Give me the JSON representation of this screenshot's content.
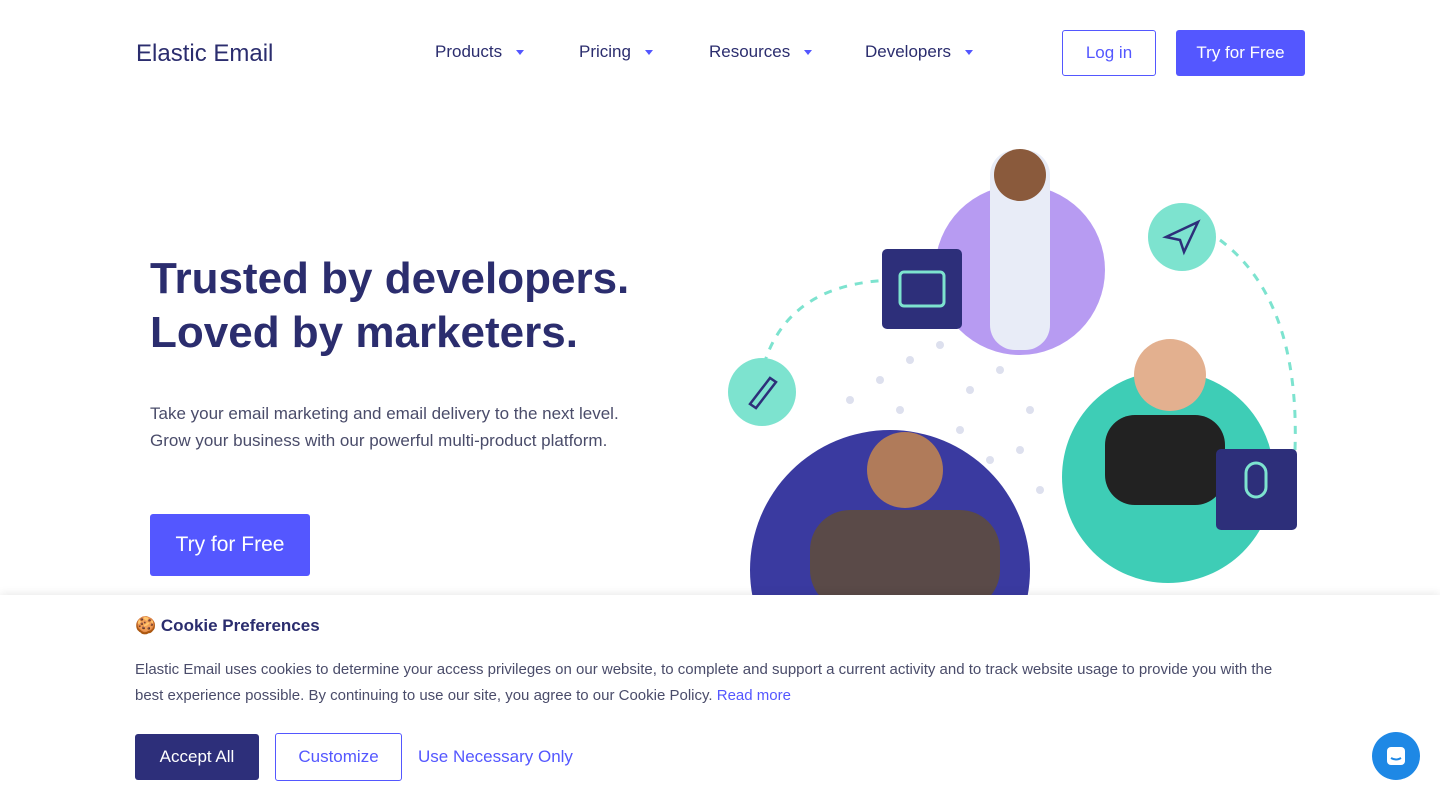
{
  "header": {
    "logo": "Elastic Email",
    "logo_icon": "link-cloud-icon",
    "nav": [
      {
        "label": "Products"
      },
      {
        "label": "Pricing"
      },
      {
        "label": "Resources"
      },
      {
        "label": "Developers"
      }
    ],
    "login": "Log in",
    "try": "Try for Free"
  },
  "hero": {
    "title_line1": "Trusted by developers.",
    "title_line2": "Loved by marketers.",
    "sub_line1": "Take your email marketing and email delivery to the next level.",
    "sub_line2": "Grow your business with our powerful multi-product platform.",
    "cta": "Try for Free"
  },
  "cookie": {
    "icon": "🍪",
    "title": "Cookie Preferences",
    "text": "Elastic Email uses cookies to determine your access privileges on our website, to complete and support a current activity and to track website usage to provide you with the best experience possible. By continuing to use our site, you agree to our Cookie Policy.",
    "read_more": "Read more",
    "accept": "Accept All",
    "customize": "Customize",
    "necessary": "Use Necessary Only"
  },
  "colors": {
    "accent": "#5457ff",
    "navy": "#2d2f7a",
    "teal": "#7de3cf",
    "purple": "#b79bf2"
  }
}
